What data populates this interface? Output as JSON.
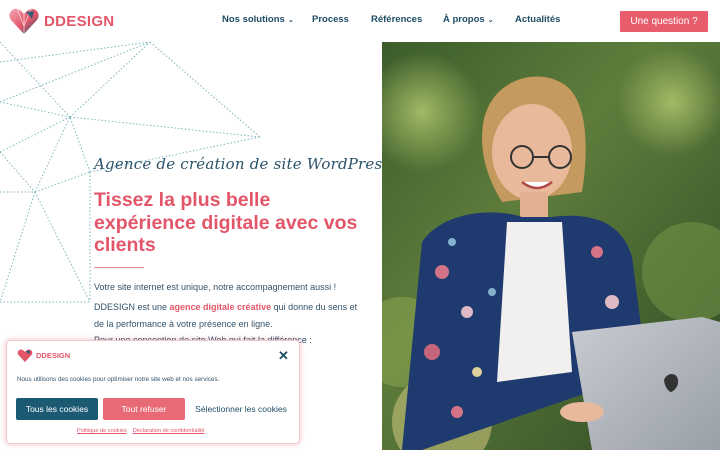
{
  "header": {
    "logo_text": "DDESIGN",
    "nav": [
      {
        "label": "Nos solutions",
        "dropdown": true
      },
      {
        "label": "Process",
        "dropdown": false
      },
      {
        "label": "Références",
        "dropdown": false
      },
      {
        "label": "À propos",
        "dropdown": true
      },
      {
        "label": "Actualités",
        "dropdown": false
      }
    ],
    "cta_label": "Une question ?"
  },
  "hero": {
    "tagline": "Agence de création de site WordPress",
    "title": "Tissez la plus belle expérience digitale avec vos clients",
    "p1": "Votre site internet est unique, notre accompagnement aussi !",
    "p2_before": "DDESIGN est une ",
    "p2_highlight": "agence digitale créative",
    "p2_after": " qui donne du sens et de la performance à votre présence en ligne.",
    "p3": "Pour une conception de site Web qui fait la différence :"
  },
  "cookie": {
    "logo_text": "DDESIGN",
    "message": "Nous utilisons des cookies pour optimiser notre site web et nos services.",
    "accept_label": "Tous les cookies",
    "refuse_label": "Tout refuser",
    "select_label": "Sélectionner les cookies",
    "links": [
      "Politique de cookies",
      "Déclaration de confidentialité"
    ]
  },
  "colors": {
    "brand_pink": "#e35669",
    "brand_navy": "#1c5a73",
    "geo_lines": "#7fb6bf"
  },
  "icons": [
    "heart-logo-icon",
    "chevron-down-icon",
    "close-icon"
  ]
}
